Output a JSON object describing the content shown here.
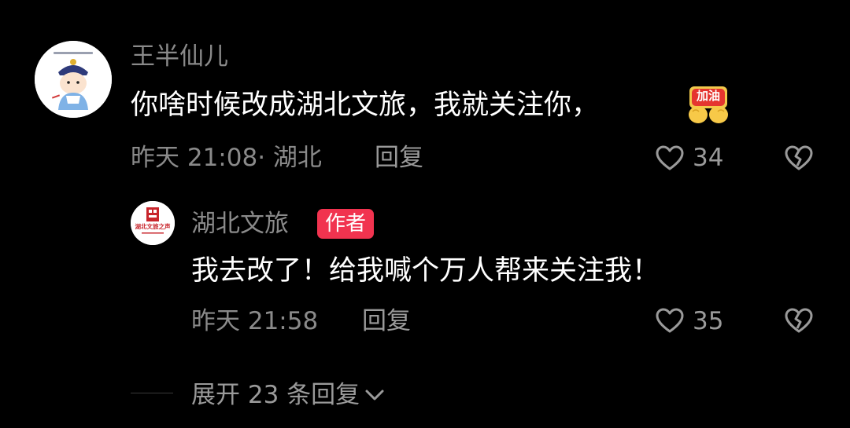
{
  "comment": {
    "username": "王半仙儿",
    "text": "你啥时候改成湖北文旅，我就关注你，",
    "sticker_label": "加油",
    "time_location": "昨天 21:08· 湖北",
    "reply_label": "回复",
    "likes": "34",
    "icons": {
      "like": "heart-outline-icon",
      "dislike": "broken-heart-icon"
    }
  },
  "reply": {
    "username": "湖北文旅",
    "badge": "作者",
    "avatar_text": "湖北文旅之声",
    "text": "我去改了！给我喊个万人帮来关注我！",
    "time": "昨天 21:58",
    "reply_label": "回复",
    "likes": "35",
    "icons": {
      "like": "heart-outline-icon",
      "dislike": "broken-heart-icon"
    }
  },
  "expand": {
    "label": "展开 23 条回复",
    "icon": "chevron-down-icon"
  },
  "colors": {
    "background": "#000000",
    "secondary_text": "#8a8a8a",
    "badge": "#f1334f"
  }
}
